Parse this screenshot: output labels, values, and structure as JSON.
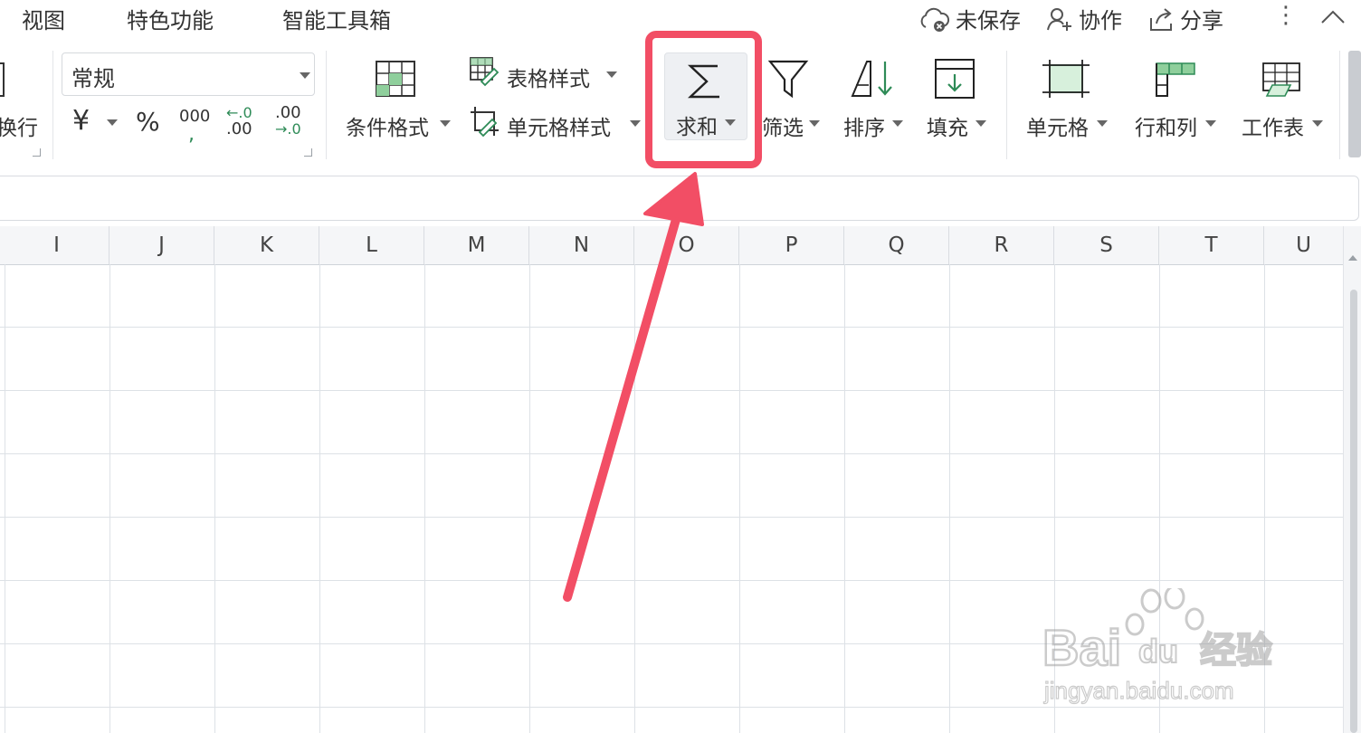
{
  "menu": {
    "items": [
      "视图",
      "特色功能",
      "智能工具箱"
    ]
  },
  "top_actions": {
    "unsaved": "未保存",
    "collaborate": "协作",
    "share": "分享"
  },
  "ribbon": {
    "wrap_text_partial": "换行",
    "number_format_value": "常规",
    "conditional_format": "条件格式",
    "table_style": "表格样式",
    "cell_style": "单元格样式",
    "sum": "求和",
    "filter": "筛选",
    "sort": "排序",
    "fill": "填充",
    "cell": "单元格",
    "row_col": "行和列",
    "worksheet": "工作表",
    "currency_symbol": "¥",
    "percent_symbol": "%",
    "thousands_symbol": "000",
    "dec_increase_top": "←.0",
    "dec_increase_bottom": ".00",
    "dec_decrease_top": ".00",
    "dec_decrease_bottom": "→.0"
  },
  "sheet": {
    "columns": [
      "I",
      "J",
      "K",
      "L",
      "M",
      "N",
      "O",
      "P",
      "Q",
      "R",
      "S",
      "T",
      "U"
    ]
  },
  "annotation": {
    "highlight_color": "#f24e65"
  },
  "watermark": {
    "line1": "Bai",
    "line2": "du",
    "line3": "经验",
    "url": "jingyan.baidu.com"
  },
  "icons": {
    "sum": "sigma-icon",
    "filter": "funnel-icon",
    "sort": "sort-icon",
    "fill": "fill-down-icon",
    "cell": "cell-icon",
    "row_col": "row-col-icon",
    "worksheet": "worksheet-icon",
    "conditional_format": "conditional-format-icon",
    "table_style": "table-style-icon",
    "cell_style": "cell-style-icon",
    "cloud": "cloud-icon",
    "collab": "person-add-icon",
    "share": "share-icon"
  }
}
